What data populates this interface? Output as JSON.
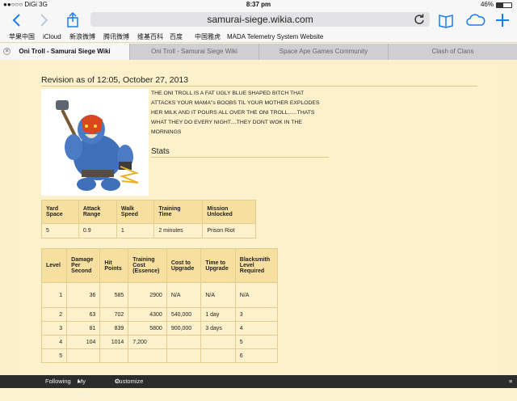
{
  "status_bar": {
    "carrier": "●●○○○ DiGi  3G",
    "time": "8:37 pm",
    "battery": "46%",
    "battery_level": 0.46
  },
  "toolbar": {
    "url": "samurai-siege.wikia.com"
  },
  "bookmarks": [
    "苹果中国",
    "iCloud",
    "新浪微博",
    "腾讯微博",
    "维基百科",
    "百度",
    "中国雅虎",
    "MADA Telemetry System Website"
  ],
  "tabs": [
    {
      "label": "Oni Troll - Samurai Siege Wiki",
      "active": true
    },
    {
      "label": "Oni Troll - Samurai Siege Wiki",
      "active": false
    },
    {
      "label": "Space Ape Games Community",
      "active": false
    },
    {
      "label": "Clash of Clans",
      "active": false
    }
  ],
  "page": {
    "revision": "Revision as of 12:05, October 27, 2013",
    "description": "THE ONI TROLL IS A FAT UGLY BLUE SHAPED BITCH THAT ATTACKS YOUR MAMA\"s BOOBS TIL YOUR MOTHER EXPLODES HER MILK AND IT POURS ALL OVER THE ONI TROLL......THATS WHAT THEY DO EVERY NIGHT....THEY DONT WOK IN THE MORNINGS",
    "stats_heading": "Stats",
    "stats_table": {
      "headers": [
        [
          "Yard",
          "Space"
        ],
        [
          "Attack",
          "Range"
        ],
        [
          "Walk",
          "Speed"
        ],
        [
          "Training",
          "Time"
        ],
        [
          "Mission",
          "Unlocked"
        ]
      ],
      "row": [
        "5",
        "0.9",
        "1",
        "2 minutes",
        "Prison Riot"
      ]
    },
    "level_table": {
      "headers": [
        [
          "Level"
        ],
        [
          "Damage",
          "Per",
          "Second"
        ],
        [
          "Hit",
          "Points"
        ],
        [
          "Training",
          "Cost",
          "(Essence)"
        ],
        [
          "Cost to",
          "Upgrade"
        ],
        [
          "Time to",
          "Upgrade"
        ],
        [
          "Blacksmith",
          "Level",
          "Required"
        ]
      ],
      "rows": [
        [
          "1",
          "36",
          "585",
          "2900",
          "N/A",
          "N/A",
          "N/A"
        ],
        [
          "2",
          "63",
          "702",
          "4300",
          "540,000",
          "1 day",
          "3"
        ],
        [
          "3",
          "81",
          "839",
          "5800",
          "900,000",
          "3 days",
          "4"
        ],
        [
          "4",
          "104",
          "1014",
          "7,200",
          "",
          "",
          "5"
        ],
        [
          "5",
          "",
          "",
          "",
          "",
          "",
          "6"
        ]
      ]
    }
  },
  "footer": {
    "following": "Following",
    "my_tools": "My Tools",
    "customize": "Customize"
  }
}
